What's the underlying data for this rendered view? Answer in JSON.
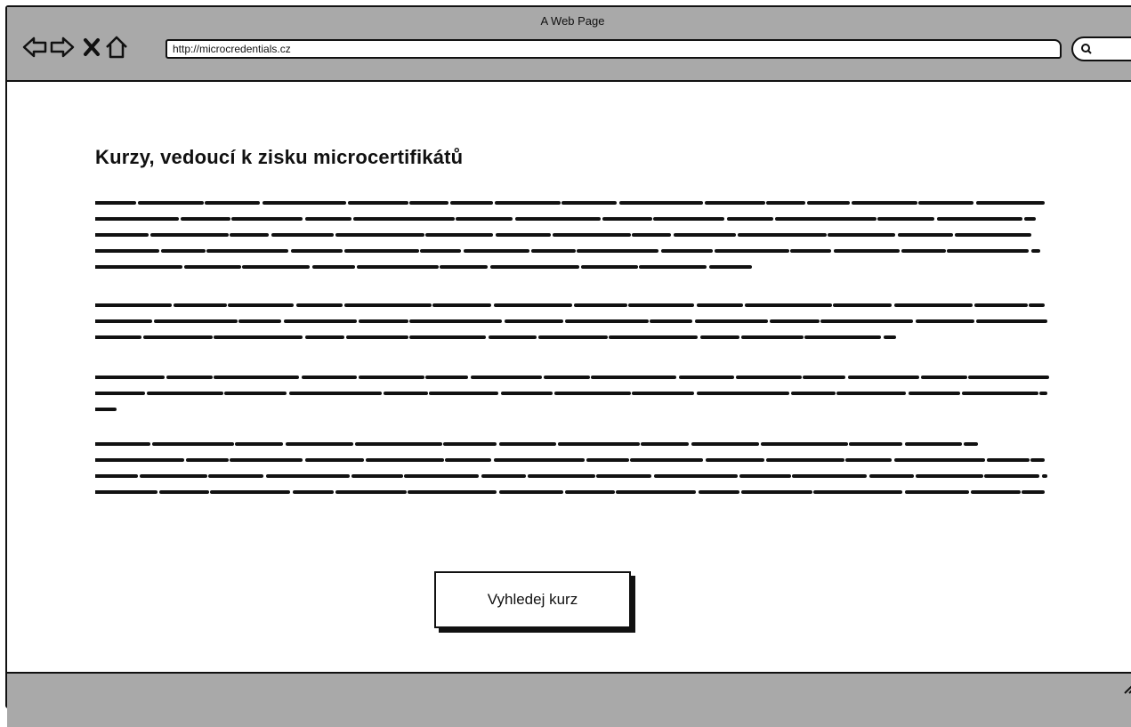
{
  "window": {
    "title": "A Web Page"
  },
  "toolbar": {
    "icons": [
      "back-arrow-icon",
      "forward-arrow-icon",
      "close-x-icon",
      "home-icon",
      "search-icon"
    ],
    "address": "http://microcredentials.cz"
  },
  "page": {
    "heading": "Kurzy, vedoucí k zisku microcertifikátů",
    "cta_label": "Vyhledej kurz"
  },
  "colors": {
    "chrome": "#a9a9a9",
    "ink": "#111111",
    "canvas": "#ffffff"
  }
}
